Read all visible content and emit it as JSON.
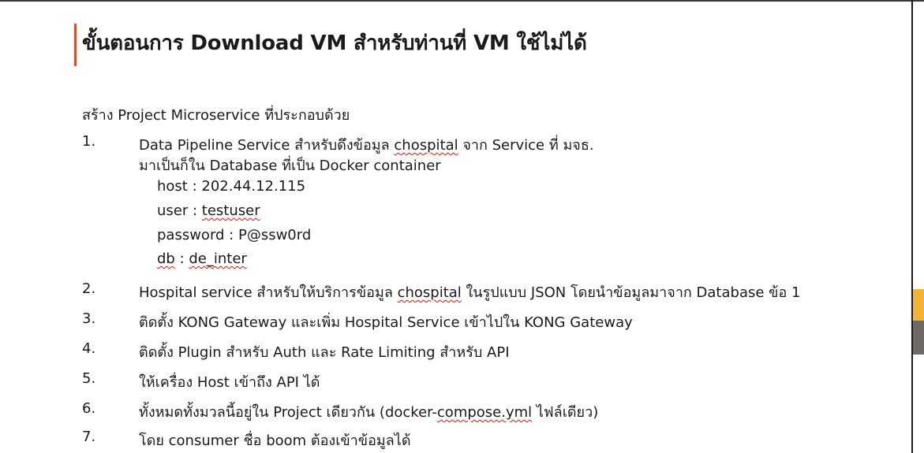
{
  "slide": {
    "title": "ขั้นตอนการ Download VM สำหรับท่านที่ VM ใช้ไม่ได้",
    "intro": "สร้าง Project Microservice ที่ประกอบด้วย"
  },
  "steps": [
    {
      "number": "1.",
      "line1": {
        "pre": "Data Pipeline Service สำหรับดึงข้อมูล ",
        "flagged": "chospital",
        "post": " จาก Service ที่ มจธ."
      },
      "line2": "มาเป็นก็ใน Database ที่เป็น Docker container",
      "details": {
        "host": {
          "label": "host : ",
          "value": "202.44.12.115"
        },
        "user": {
          "label": "user : ",
          "value": "testuser"
        },
        "password": {
          "label": "password : ",
          "value": "P@ssw0rd"
        },
        "db": {
          "label": "db",
          "sep": " : ",
          "value": "de_inter"
        }
      }
    },
    {
      "number": "2.",
      "pre": "Hospital service สำหรับให้บริการข้อมูล ",
      "flagged": "chospital",
      "post": " ในรูปแบบ JSON โดยนำข้อมูลมาจาก Database ข้อ 1"
    },
    {
      "number": "3.",
      "text": "ติดตั้ง KONG Gateway และเพิ่ม Hospital Service เข้าไปใน KONG Gateway"
    },
    {
      "number": "4.",
      "text": "ติดตั้ง Plugin สำหรับ Auth และ Rate Limiting สำหรับ API"
    },
    {
      "number": "5.",
      "text": "ให้เครื่อง Host เข้าถึง API ได้"
    },
    {
      "number": "6.",
      "pre": "ทั้งหมดทั้งมวลนี้อยู่ใน Project เดียวกัน (docker-",
      "flagged": "compose.yml",
      "post": " ไฟล์เดียว)"
    },
    {
      "number": "7.",
      "text": "โดย consumer ชื่อ boom ต้องเข้าข้อมูลได้"
    }
  ],
  "theme": {
    "title_accent": "#e8491d",
    "side_orange": "#f5b335",
    "side_gray": "#6d6a66",
    "spellcheck_color": "#dd1111"
  }
}
